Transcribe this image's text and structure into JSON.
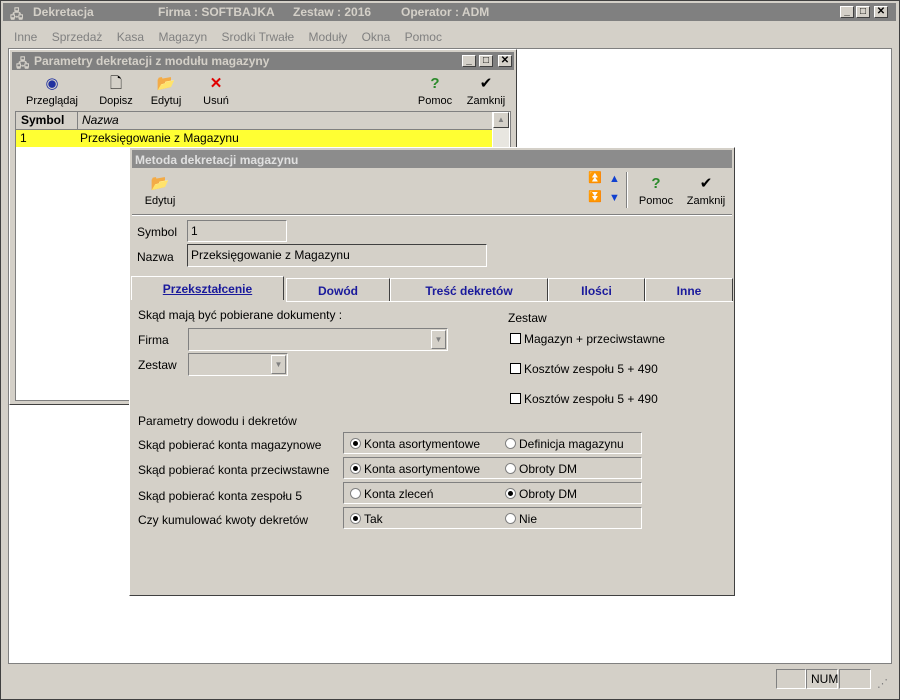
{
  "app": {
    "title": "Dekretacja",
    "firma": "Firma : SOFTBAJKA",
    "zestaw": "Zestaw : 2016",
    "operator": "Operator : ADM"
  },
  "menu": [
    "Inne",
    "Sprzedaż",
    "Kasa",
    "Magazyn",
    "Srodki Trwałe",
    "Moduły",
    "Okna",
    "Pomoc"
  ],
  "params_window": {
    "title": "Parametry dekretacji z modułu magazyny",
    "toolbar": {
      "browse": "Przeglądaj",
      "add": "Dopisz",
      "edit": "Edytuj",
      "delete": "Usuń",
      "help": "Pomoc",
      "close": "Zamknij"
    },
    "columns": [
      "Symbol",
      "Nazwa"
    ],
    "rows": [
      {
        "symbol": "1",
        "name": "Przeksięgowanie z Magazynu"
      }
    ]
  },
  "method_window": {
    "title": "Metoda dekretacji magazynu",
    "toolbar": {
      "edit": "Edytuj",
      "help": "Pomoc",
      "close": "Zamknij"
    },
    "symbol_label": "Symbol",
    "symbol_value": "1",
    "name_label": "Nazwa",
    "name_value": "Przeksięgowanie z Magazynu",
    "tabs": [
      "Przekształcenie",
      "Dowód",
      "Treść dekretów",
      "Ilości",
      "Inne"
    ],
    "source_heading": "Skąd mają być pobierane dokumenty :",
    "firma_label": "Firma",
    "zestaw_label": "Zestaw",
    "zestaw_group": {
      "heading": "Zestaw",
      "options": [
        "Magazyn + przeciwstawne",
        "Kosztów zespołu 5 + 490",
        "Kosztów zespołu 5 + 490"
      ]
    },
    "params_heading": "Parametry dowodu i dekretów",
    "radio_rows": [
      {
        "label": "Skąd pobierać konta magazynowe",
        "opt1": "Konta asortymentowe",
        "opt2": "Definicja magazynu",
        "selected": 1
      },
      {
        "label": "Skąd pobierać konta przeciwstawne",
        "opt1": "Konta asortymentowe",
        "opt2": "Obroty DM",
        "selected": 1
      },
      {
        "label": "Skąd pobierać konta zespołu 5",
        "opt1": "Konta zleceń",
        "opt2": "Obroty DM",
        "selected": 2
      },
      {
        "label": "Czy kumulować kwoty dekretów",
        "opt1": "Tak",
        "opt2": "Nie",
        "selected": 1
      }
    ]
  },
  "statusbar": {
    "num": "NUM"
  },
  "colors": {
    "selected_row": "#ffff33",
    "tab_text": "#1a1a9c",
    "window_bg": "#d4d0c8"
  }
}
